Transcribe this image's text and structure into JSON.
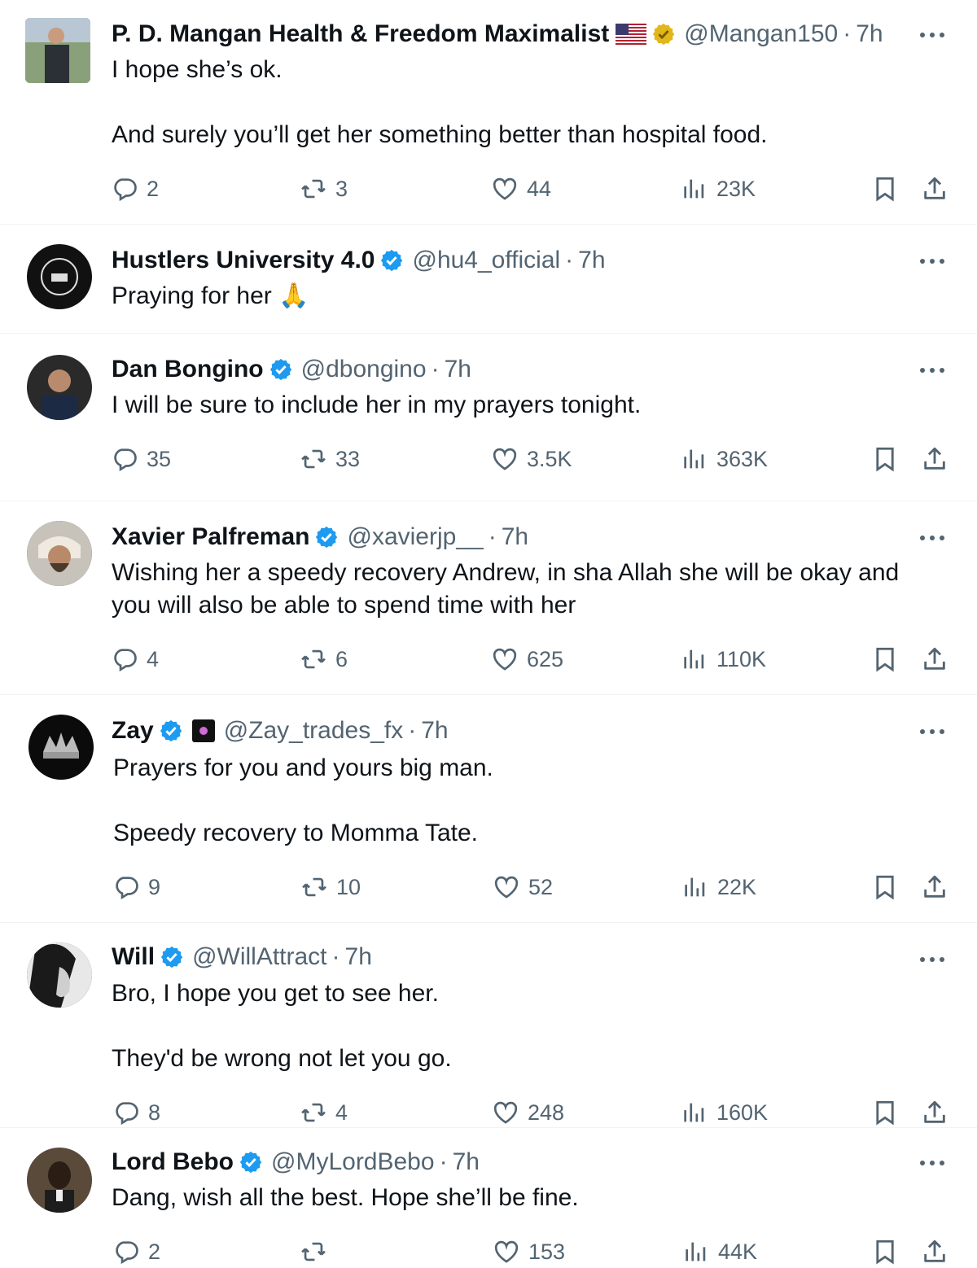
{
  "colors": {
    "verified_blue": "#1d9bf0",
    "verified_gold": "#e2b719",
    "text": "#0f1419",
    "muted": "#536471",
    "divider": "#eff3f4"
  },
  "icons": {
    "reply": "reply-icon",
    "retweet": "retweet-icon",
    "like": "heart-icon",
    "views": "views-chart-icon",
    "bookmark": "bookmark-icon",
    "share": "share-icon",
    "more": "more-dots-icon"
  },
  "tweets": [
    {
      "name": "P. D. Mangan Health & Freedom Maximalist",
      "handle": "@Mangan150",
      "time": "7h",
      "text": "I hope she’s ok.\n\nAnd surely you’ll get her something better than hospital food.",
      "reply": "2",
      "retweet": "3",
      "like": "44",
      "views": "23K"
    },
    {
      "name": "Hustlers University 4.0",
      "handle": "@hu4_official",
      "time": "7h",
      "text": "Praying for her 🙏"
    },
    {
      "name": "Dan Bongino",
      "handle": "@dbongino",
      "time": "7h",
      "text": "I will be sure to include her in my prayers tonight.",
      "reply": "35",
      "retweet": "33",
      "like": "3.5K",
      "views": "363K"
    },
    {
      "name": "Xavier Palfreman",
      "handle": "@xavierjp__",
      "time": "7h",
      "text": "Wishing her a speedy recovery Andrew, in sha Allah she will be okay and\nyou will also be able to spend time with her",
      "reply": "4",
      "retweet": "6",
      "like": "625",
      "views": "110K"
    },
    {
      "name": "Zay",
      "handle": "@Zay_trades_fx",
      "time": "7h",
      "text": "Prayers for you and yours big man.\n\nSpeedy recovery to Momma Tate.",
      "reply": "9",
      "retweet": "10",
      "like": "52",
      "views": "22K"
    },
    {
      "name": "Will",
      "handle": "@WillAttract",
      "time": "7h",
      "text": "Bro, I hope you get to see her.\n\nThey'd be wrong not let you go.",
      "reply": "8",
      "retweet": "4",
      "like": "248",
      "views": "160K"
    },
    {
      "name": "Lord Bebo",
      "handle": "@MyLordBebo",
      "time": "7h",
      "text": "Dang, wish all the best. Hope she’ll be fine.",
      "reply": "2",
      "retweet": "",
      "like": "153",
      "views": "44K"
    }
  ]
}
